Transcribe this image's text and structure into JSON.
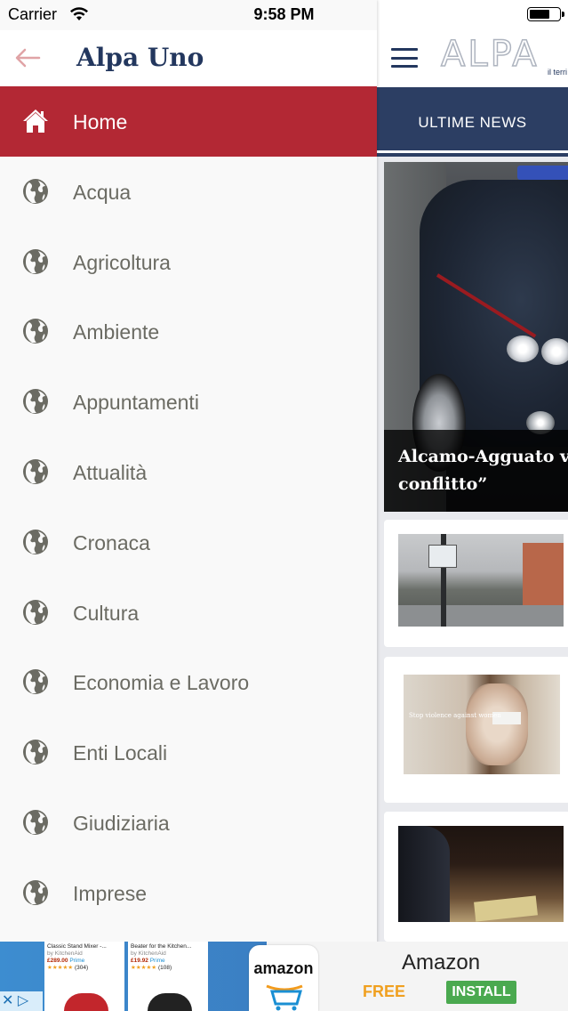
{
  "status_bar": {
    "carrier": "Carrier",
    "time": "9:58 PM"
  },
  "drawer": {
    "title": "Alpa Uno",
    "back_icon": "back-arrow-icon",
    "menu_icon": "globe-icon",
    "home_icon": "home-icon",
    "items": [
      {
        "label": "Home",
        "active": true
      },
      {
        "label": "Acqua"
      },
      {
        "label": "Agricoltura"
      },
      {
        "label": "Ambiente"
      },
      {
        "label": "Appuntamenti"
      },
      {
        "label": "Attualità"
      },
      {
        "label": "Cronaca"
      },
      {
        "label": "Cultura"
      },
      {
        "label": "Economia e Lavoro"
      },
      {
        "label": "Enti Locali"
      },
      {
        "label": "Giudiziaria"
      },
      {
        "label": "Imprese"
      }
    ]
  },
  "main": {
    "logo_text": "ALPA",
    "logo_sub": "il terri",
    "tab_label": "ULTIME NEWS",
    "hero": {
      "caption_line1": "Alcamo-Agguato via",
      "caption_line2": "conflitto”"
    },
    "thumb2_text": "Stop violence against women",
    "thumb2_tape_text": "Speak!"
  },
  "ad": {
    "product1_title": "Classic Stand Mixer -...",
    "product1_by": "by KitchenAid",
    "product1_price": "£289.00",
    "product1_prime": "Prime",
    "product1_rating": "(304)",
    "product2_title": "Beater for the Kitchen...",
    "product2_by": "by KitchenAid",
    "product2_price": "£19.92",
    "product2_prime": "Prime",
    "product2_rating": "(108)",
    "tile_word": "amazon",
    "app_name": "Amazon",
    "free_label": "FREE",
    "install_label": "INSTALL"
  },
  "colors": {
    "accent_red": "#b32834",
    "navy": "#23375e",
    "tab_bar": "#2c3e63",
    "install_green": "#4aa94f"
  }
}
